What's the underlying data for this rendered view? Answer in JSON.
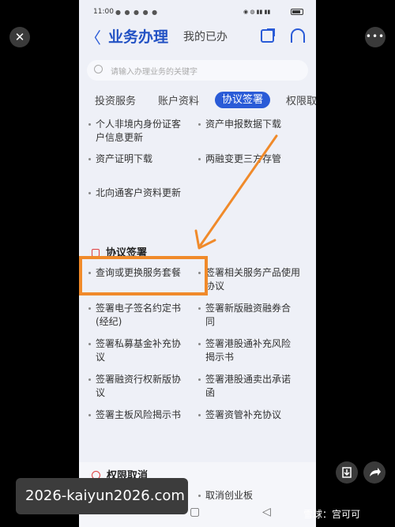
{
  "viewer": {
    "close_glyph": "✕",
    "more_glyph": "•••",
    "save_icon": "download-icon",
    "share_icon": "share-icon"
  },
  "status": {
    "time": "11:00",
    "battery_level": 0.8
  },
  "nav": {
    "back_glyph": "〈",
    "title": "业务办理",
    "mine": "我的已办",
    "share_icon": "share-icon",
    "service_icon": "headset-icon"
  },
  "search": {
    "placeholder": "请输入办理业务的关键字"
  },
  "tabs": [
    "投资服务",
    "账户资料",
    "协议签署",
    "权限取"
  ],
  "active_tab": 2,
  "account_items": [
    "个人非境内身份证客户信息更新",
    "资产申报数据下载",
    "资产证明下载",
    "两融变更三方存管",
    "北向通客户资料更新"
  ],
  "agreement_section": {
    "title": "协议签署",
    "items": [
      "查询或更换服务套餐",
      "签署相关服务产品使用协议",
      "签署电子签名约定书(经纪)",
      "签署新版融资融券合同",
      "签署私募基金补充协议",
      "签署港股通补充风险揭示书",
      "签署融资行权新版协议",
      "签署港股通卖出承诺函",
      "签署主板风险揭示书",
      "签署资管补充协议"
    ]
  },
  "revoke_section": {
    "title": "权限取消",
    "items": [
      "取消创业板"
    ]
  },
  "watermarks": {
    "left": "2026-kaiyun2026.com",
    "right": "雪球：宫可可"
  },
  "highlight_color": "#f08a2a"
}
